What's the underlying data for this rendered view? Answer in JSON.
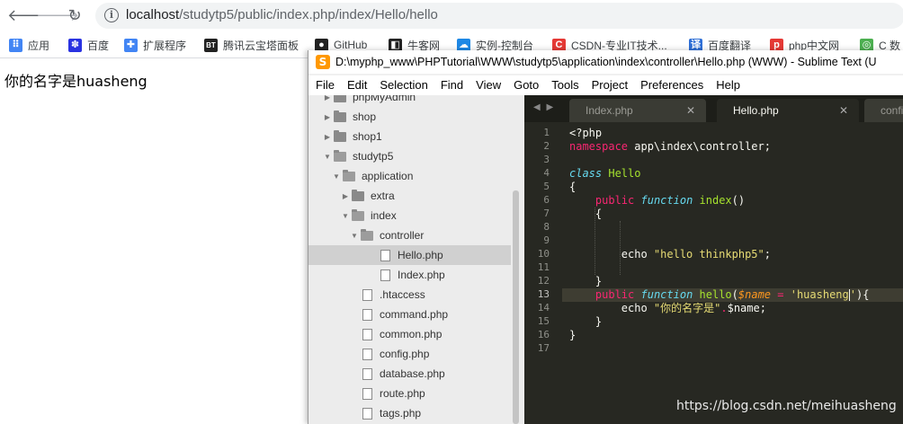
{
  "browser": {
    "url_host": "localhost",
    "url_path": "/studytp5/public/index.php/index/Hello/hello",
    "bookmarks": [
      {
        "label": "应用",
        "icon": "apps-grid-icon",
        "color": "#4285f4"
      },
      {
        "label": "百度",
        "icon": "paw-icon",
        "color": "#2932e1"
      },
      {
        "label": "扩展程序",
        "icon": "puzzle-icon",
        "color": "#4285f4"
      },
      {
        "label": "腾讯云宝塔面板",
        "icon": "bt-icon",
        "color": "#222222"
      },
      {
        "label": "GitHub",
        "icon": "github-icon",
        "color": "#222222"
      },
      {
        "label": "牛客网",
        "icon": "nowcoder-icon",
        "color": "#222222"
      },
      {
        "label": "实例-控制台",
        "icon": "cloud-icon",
        "color": "#1e88e5"
      },
      {
        "label": "CSDN-专业IT技术...",
        "icon": "csdn-icon",
        "color": "#e53935"
      },
      {
        "label": "百度翻译",
        "icon": "translate-icon",
        "color": "#2f6fd6"
      },
      {
        "label": "php中文网",
        "icon": "php-icon",
        "color": "#e53935"
      },
      {
        "label": "C 数",
        "icon": "bookmark-icon",
        "color": "#4caf50"
      }
    ]
  },
  "page": {
    "output_text": "你的名字是huasheng"
  },
  "sublime": {
    "title": "D:\\myphp_www\\PHPTutorial\\WWW\\studytp5\\application\\index\\controller\\Hello.php (WWW) - Sublime Text (U",
    "menu": [
      "File",
      "Edit",
      "Selection",
      "Find",
      "View",
      "Goto",
      "Tools",
      "Project",
      "Preferences",
      "Help"
    ],
    "sidebar": [
      {
        "label": "phpMyAdmin",
        "kind": "folder",
        "level": 0,
        "open": false
      },
      {
        "label": "shop",
        "kind": "folder",
        "level": 0,
        "open": false
      },
      {
        "label": "shop1",
        "kind": "folder",
        "level": 0,
        "open": false
      },
      {
        "label": "studytp5",
        "kind": "folder",
        "level": 0,
        "open": true
      },
      {
        "label": "application",
        "kind": "folder",
        "level": 1,
        "open": true
      },
      {
        "label": "extra",
        "kind": "folder",
        "level": 2,
        "open": false
      },
      {
        "label": "index",
        "kind": "folder",
        "level": 2,
        "open": true
      },
      {
        "label": "controller",
        "kind": "folder",
        "level": 3,
        "open": true
      },
      {
        "label": "Hello.php",
        "kind": "file",
        "level": 4,
        "selected": true
      },
      {
        "label": "Index.php",
        "kind": "file",
        "level": 4
      },
      {
        "label": ".htaccess",
        "kind": "file",
        "level": 2
      },
      {
        "label": "command.php",
        "kind": "file",
        "level": 2
      },
      {
        "label": "common.php",
        "kind": "file",
        "level": 2
      },
      {
        "label": "config.php",
        "kind": "file",
        "level": 2
      },
      {
        "label": "database.php",
        "kind": "file",
        "level": 2
      },
      {
        "label": "route.php",
        "kind": "file",
        "level": 2
      },
      {
        "label": "tags.php",
        "kind": "file",
        "level": 2
      }
    ],
    "tabs": [
      {
        "label": "Index.php",
        "active": false
      },
      {
        "label": "Hello.php",
        "active": true
      },
      {
        "label": "config",
        "active": false
      }
    ],
    "current_line": 13,
    "code_lines": [
      [
        {
          "t": "<?php",
          "c": ""
        }
      ],
      [
        {
          "t": "namespace",
          "c": "kw"
        },
        {
          "t": " app\\index\\controller;",
          "c": ""
        }
      ],
      [],
      [
        {
          "t": "class",
          "c": "it"
        },
        {
          "t": " ",
          "c": ""
        },
        {
          "t": "Hello",
          "c": "cls"
        }
      ],
      [
        {
          "t": "{",
          "c": ""
        }
      ],
      [
        {
          "t": "    ",
          "c": ""
        },
        {
          "t": "public",
          "c": "kw"
        },
        {
          "t": " ",
          "c": ""
        },
        {
          "t": "function",
          "c": "it"
        },
        {
          "t": " ",
          "c": ""
        },
        {
          "t": "index",
          "c": "fn"
        },
        {
          "t": "()",
          "c": ""
        }
      ],
      [
        {
          "t": "    {",
          "c": ""
        }
      ],
      [],
      [],
      [
        {
          "t": "        echo ",
          "c": ""
        },
        {
          "t": "\"hello thinkphp5\"",
          "c": "str"
        },
        {
          "t": ";",
          "c": ""
        }
      ],
      [],
      [
        {
          "t": "    }",
          "c": ""
        }
      ],
      [
        {
          "t": "    ",
          "c": ""
        },
        {
          "t": "public",
          "c": "kw"
        },
        {
          "t": " ",
          "c": ""
        },
        {
          "t": "function",
          "c": "it"
        },
        {
          "t": " ",
          "c": ""
        },
        {
          "t": "hello",
          "c": "fn"
        },
        {
          "t": "(",
          "c": ""
        },
        {
          "t": "$name",
          "c": "par"
        },
        {
          "t": " ",
          "c": ""
        },
        {
          "t": "=",
          "c": "kw"
        },
        {
          "t": " ",
          "c": ""
        },
        {
          "t": "'huasheng",
          "c": "str"
        },
        {
          "t": "|",
          "c": "caret"
        },
        {
          "t": "'",
          "c": "str"
        },
        {
          "t": "){",
          "c": ""
        }
      ],
      [
        {
          "t": "        echo ",
          "c": ""
        },
        {
          "t": "\"你的名字是\"",
          "c": "str"
        },
        {
          "t": ".",
          "c": "kw"
        },
        {
          "t": "$name;",
          "c": ""
        }
      ],
      [
        {
          "t": "    }",
          "c": ""
        }
      ],
      [
        {
          "t": "}",
          "c": ""
        }
      ],
      []
    ]
  },
  "watermark": "https://blog.csdn.net/meihuasheng"
}
